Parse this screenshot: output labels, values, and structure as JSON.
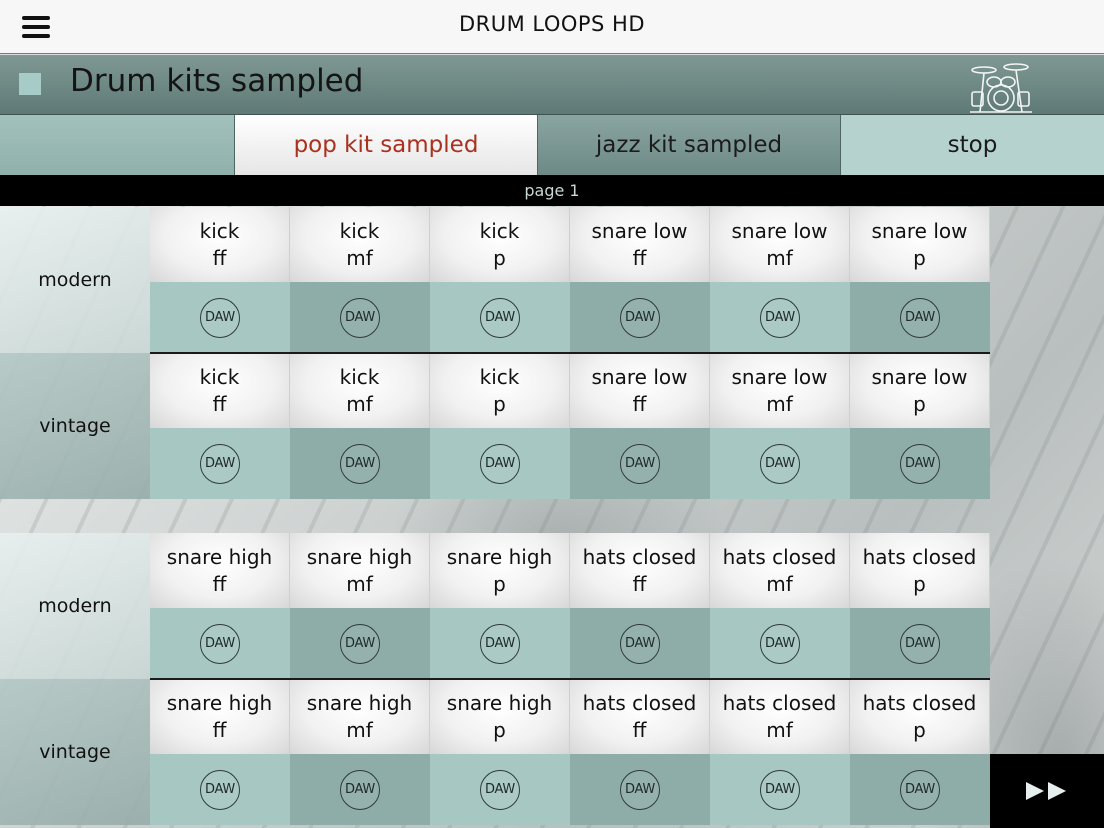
{
  "app": {
    "title": "DRUM LOOPS HD"
  },
  "header": {
    "title": "Drum kits sampled"
  },
  "tabs": {
    "pop": "pop kit sampled",
    "jazz": "jazz kit sampled",
    "stop": "stop"
  },
  "page_label": "page 1",
  "daw_label": "DAW",
  "groups": [
    {
      "rows": [
        {
          "label": "modern",
          "cells": [
            {
              "l1": "kick",
              "l2": "ff"
            },
            {
              "l1": "kick",
              "l2": "mf"
            },
            {
              "l1": "kick",
              "l2": "p"
            },
            {
              "l1": "snare low",
              "l2": "ff"
            },
            {
              "l1": "snare low",
              "l2": "mf"
            },
            {
              "l1": "snare low",
              "l2": "p"
            }
          ]
        },
        {
          "label": "vintage",
          "cells": [
            {
              "l1": "kick",
              "l2": "ff"
            },
            {
              "l1": "kick",
              "l2": "mf"
            },
            {
              "l1": "kick",
              "l2": "p"
            },
            {
              "l1": "snare low",
              "l2": "ff"
            },
            {
              "l1": "snare low",
              "l2": "mf"
            },
            {
              "l1": "snare low",
              "l2": "p"
            }
          ]
        }
      ]
    },
    {
      "rows": [
        {
          "label": "modern",
          "cells": [
            {
              "l1": "snare high",
              "l2": "ff"
            },
            {
              "l1": "snare high",
              "l2": "mf"
            },
            {
              "l1": "snare high",
              "l2": "p"
            },
            {
              "l1": "hats closed",
              "l2": "ff"
            },
            {
              "l1": "hats closed",
              "l2": "mf"
            },
            {
              "l1": "hats closed",
              "l2": "p"
            }
          ]
        },
        {
          "label": "vintage",
          "cells": [
            {
              "l1": "snare high",
              "l2": "ff"
            },
            {
              "l1": "snare high",
              "l2": "mf"
            },
            {
              "l1": "snare high",
              "l2": "p"
            },
            {
              "l1": "hats closed",
              "l2": "ff"
            },
            {
              "l1": "hats closed",
              "l2": "mf"
            },
            {
              "l1": "hats closed",
              "l2": "p"
            }
          ]
        }
      ]
    }
  ],
  "icons": {
    "menu": "hamburger-menu-icon",
    "header_square": "square-icon",
    "drumkit": "drum-kit-icon",
    "fast_forward": "fast-forward-icon"
  },
  "colors": {
    "header_bg": "#6b8682",
    "daw_light": "#a6c7c2",
    "daw_dark": "#8fada8",
    "active_tab_text": "#a8321f",
    "page_bar": "#000000"
  }
}
